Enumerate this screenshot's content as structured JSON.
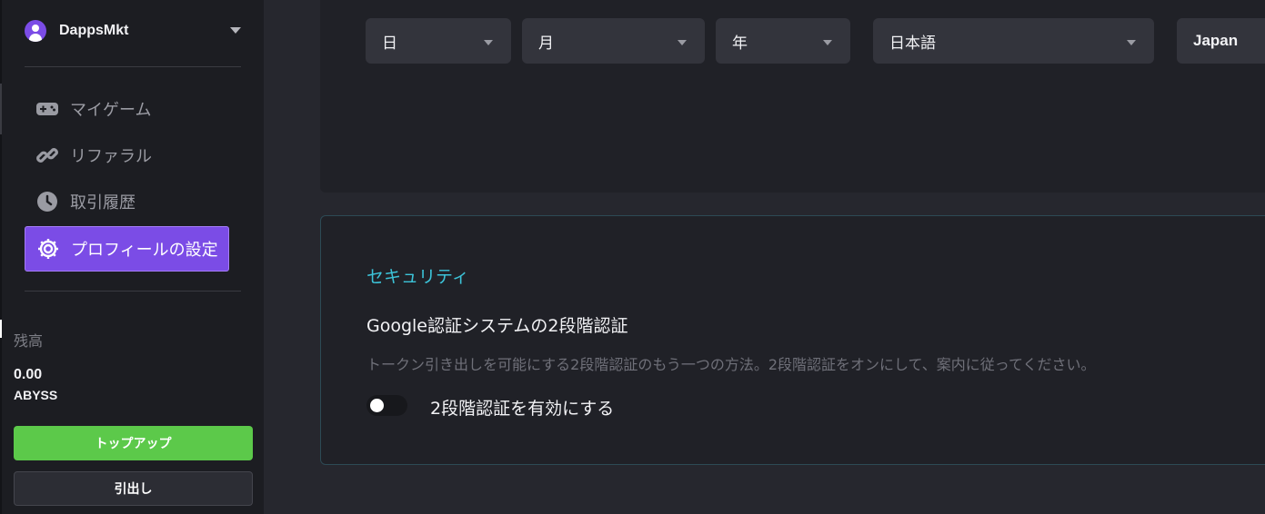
{
  "user": {
    "name": "DappsMkt"
  },
  "nav": {
    "items": [
      {
        "label": "マイゲーム",
        "icon": "gamepad-icon"
      },
      {
        "label": "リファラル",
        "icon": "link-icon"
      },
      {
        "label": "取引履歴",
        "icon": "clock-icon"
      },
      {
        "label": "プロフィールの設定",
        "icon": "gear-icon",
        "active": true
      }
    ]
  },
  "balance": {
    "label": "残高",
    "amount": "0.00",
    "currency": "ABYSS"
  },
  "buttons": {
    "topup": "トップアップ",
    "withdraw": "引出し"
  },
  "profile": {
    "day": "日",
    "month": "月",
    "year": "年",
    "language": "日本語",
    "country": "Japan"
  },
  "security": {
    "title": "セキュリティ",
    "subtitle": "Google認証システムの2段階認証",
    "description": "トークン引き出しを可能にする2段階認証のもう一つの方法。2段階認証をオンにして、案内に従ってください。",
    "toggle_label": "2段階認証を有効にする",
    "toggle_enabled": false
  },
  "colors": {
    "accent": "#7b4ce6",
    "topup": "#5cc94a",
    "security_title": "#3cc3d8"
  }
}
